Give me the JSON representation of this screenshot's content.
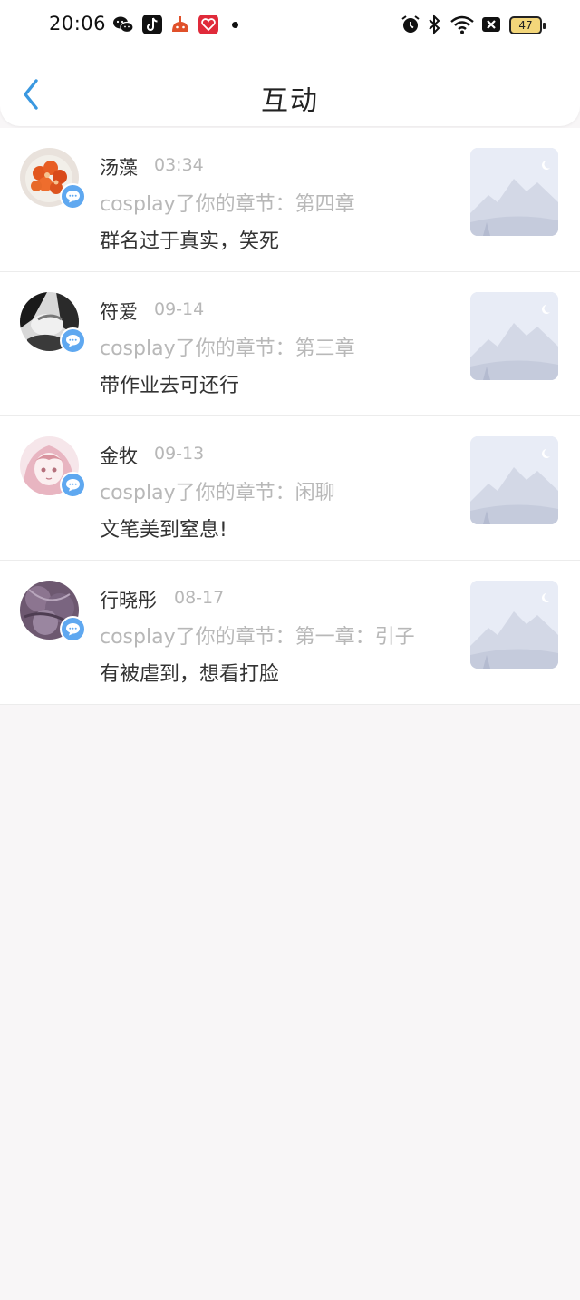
{
  "status_bar": {
    "time": "20:06",
    "battery": "47"
  },
  "header": {
    "title": "互动"
  },
  "items": [
    {
      "name": "汤藻",
      "time": "03:34",
      "subtitle": "cosplay了你的章节：第四章",
      "message": "群名过于真实，笑死"
    },
    {
      "name": "符爱",
      "time": "09-14",
      "subtitle": "cosplay了你的章节：第三章",
      "message": "带作业去可还行"
    },
    {
      "name": "金牧",
      "time": "09-13",
      "subtitle": "cosplay了你的章节：闲聊",
      "message": "文笔美到窒息!"
    },
    {
      "name": "行晓彤",
      "time": "08-17",
      "subtitle": "cosplay了你的章节：第一章：引子",
      "message": "有被虐到，想看打脸"
    }
  ],
  "colors": {
    "accent": "#3a98e0",
    "badge": "#5fa8f0",
    "background": "#f8f6f7"
  }
}
